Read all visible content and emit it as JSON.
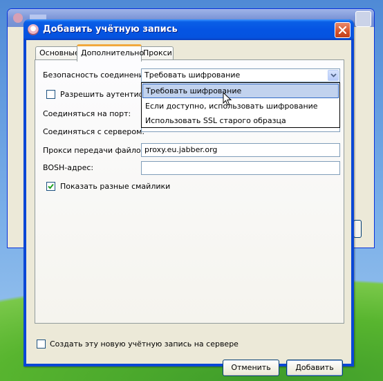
{
  "dialog": {
    "title": "Добавить учётную запись",
    "tabs": [
      {
        "label": "Основные",
        "active": false
      },
      {
        "label": "Дополнительно",
        "active": true
      },
      {
        "label": "Прокси",
        "active": false
      }
    ]
  },
  "advanced": {
    "security_label": "Безопасность соединения:",
    "security_value": "Требовать шифрование",
    "security_options": [
      "Требовать шифрование",
      "Если доступно, использовать шифрование",
      "Использовать SSL старого образца"
    ],
    "auth_checkbox_label": "Разрешить аутентифик",
    "auth_checkbox_checked": false,
    "port_label": "Соединяться на порт:",
    "server_label": "Соединяться с сервером:",
    "proxy_label": "Прокси передачи файлов:",
    "proxy_value": "proxy.eu.jabber.org",
    "bosh_label": "BOSH-адрес:",
    "bosh_value": "",
    "smileys_label": "Показать разные смайлики",
    "smileys_checked": true
  },
  "footer": {
    "create_label": "Создать эту новую учётную запись на сервере",
    "create_checked": false,
    "cancel_label": "Отменить",
    "add_label": "Добавить"
  },
  "icons": {
    "app": "pidgin-icon",
    "close": "close-icon",
    "dropdown": "chevron-down-icon",
    "check": "check-icon",
    "cursor": "mouse-pointer-icon"
  }
}
